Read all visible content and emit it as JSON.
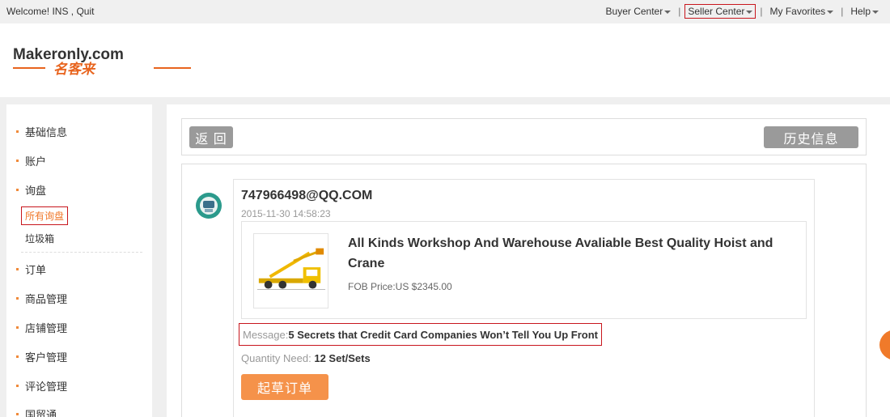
{
  "topbar": {
    "welcome": "Welcome!  INS , Quit",
    "nav": [
      {
        "label": "Buyer Center"
      },
      {
        "label": "Seller Center"
      },
      {
        "label": "My Favorites"
      },
      {
        "label": "Help"
      }
    ]
  },
  "header": {
    "logo_text": "Makeronly.com",
    "logo_sub": "名客来"
  },
  "sidebar": {
    "items": [
      {
        "label": "基础信息"
      },
      {
        "label": "账户"
      },
      {
        "label": "询盘"
      },
      {
        "label": "订单"
      },
      {
        "label": "商品管理"
      },
      {
        "label": "店铺管理"
      },
      {
        "label": "客户管理"
      },
      {
        "label": "评论管理"
      },
      {
        "label": "国贸通"
      }
    ],
    "sub": [
      {
        "label": "所有询盘"
      },
      {
        "label": "垃圾箱"
      }
    ]
  },
  "main": {
    "back_label": "返 回",
    "history_label": "历史信息",
    "inquiry": {
      "sender": "747966498@QQ.COM",
      "time": "2015-11-30 14:58:23",
      "product_title": "All Kinds Workshop And Warehouse Avaliable Best Quality Hoist and Crane",
      "price": "FOB Price:US $2345.00",
      "message_label": "Message:",
      "message": "5 Secrets that Credit Card Companies Won’t Tell You Up Front",
      "qty_label": "Quantity Need:",
      "qty": "12 Set/Sets",
      "draft_label": "起草订单"
    }
  },
  "colors": {
    "accent": "#f5924a",
    "highlight": "#c8161d",
    "button_grey": "#9a9a9a"
  }
}
